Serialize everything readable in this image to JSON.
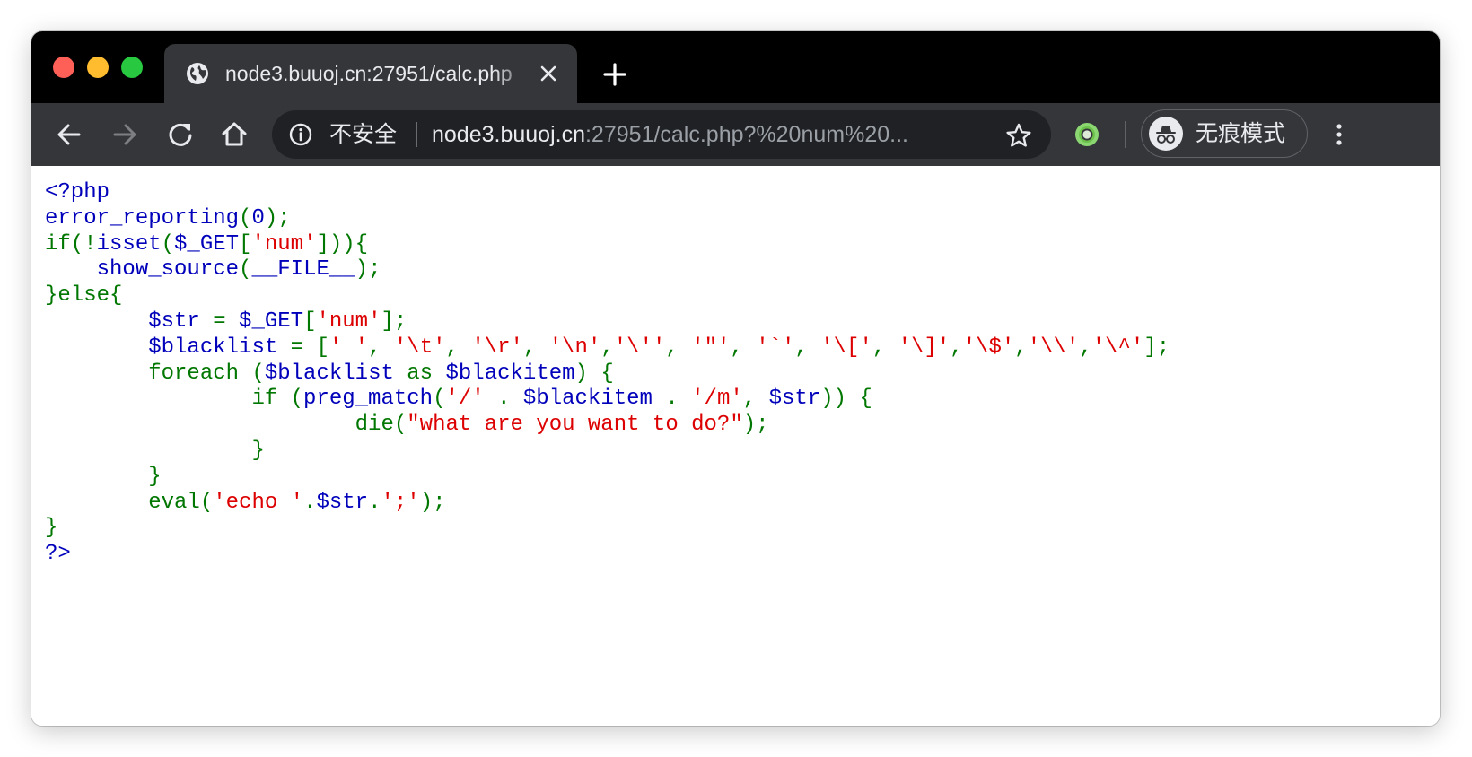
{
  "browser": {
    "tab": {
      "title": "node3.buuoj.cn:27951/calc.php"
    },
    "omnibox": {
      "security_label": "不安全",
      "url_host": "node3.buuoj.cn",
      "url_rest": ":27951/calc.php?%20num%20..."
    },
    "profile": {
      "label": "无痕模式"
    }
  },
  "colors": {
    "php_default": "#0000bb",
    "php_keyword": "#007700",
    "php_string": "#dd0000",
    "tabstrip_bg": "#000000",
    "toolbar_bg": "#35363a"
  },
  "icons": [
    "globe-icon",
    "close-icon",
    "plus-icon",
    "back-arrow-icon",
    "forward-arrow-icon",
    "reload-icon",
    "home-icon",
    "info-icon",
    "star-icon",
    "extension-icon",
    "incognito-icon",
    "kebab-menu-icon"
  ],
  "code": {
    "lines": [
      [
        {
          "t": "<?php",
          "c": "blue"
        }
      ],
      [
        {
          "t": "error_reporting",
          "c": "blue"
        },
        {
          "t": "(",
          "c": "green"
        },
        {
          "t": "0",
          "c": "blue"
        },
        {
          "t": ");",
          "c": "green"
        }
      ],
      [
        {
          "t": "if(!",
          "c": "green"
        },
        {
          "t": "isset",
          "c": "blue"
        },
        {
          "t": "(",
          "c": "green"
        },
        {
          "t": "$_GET",
          "c": "blue"
        },
        {
          "t": "[",
          "c": "green"
        },
        {
          "t": "'num'",
          "c": "red"
        },
        {
          "t": "])){",
          "c": "green"
        }
      ],
      [
        {
          "t": "    show_source",
          "c": "blue"
        },
        {
          "t": "(",
          "c": "green"
        },
        {
          "t": "__FILE__",
          "c": "blue"
        },
        {
          "t": ");",
          "c": "green"
        }
      ],
      [
        {
          "t": "}else{",
          "c": "green"
        }
      ],
      [
        {
          "t": "        $str ",
          "c": "blue"
        },
        {
          "t": "= ",
          "c": "green"
        },
        {
          "t": "$_GET",
          "c": "blue"
        },
        {
          "t": "[",
          "c": "green"
        },
        {
          "t": "'num'",
          "c": "red"
        },
        {
          "t": "];",
          "c": "green"
        }
      ],
      [
        {
          "t": "        $blacklist ",
          "c": "blue"
        },
        {
          "t": "= [",
          "c": "green"
        },
        {
          "t": "' '",
          "c": "red"
        },
        {
          "t": ", ",
          "c": "green"
        },
        {
          "t": "'\\t'",
          "c": "red"
        },
        {
          "t": ", ",
          "c": "green"
        },
        {
          "t": "'\\r'",
          "c": "red"
        },
        {
          "t": ", ",
          "c": "green"
        },
        {
          "t": "'\\n'",
          "c": "red"
        },
        {
          "t": ",",
          "c": "green"
        },
        {
          "t": "'\\''",
          "c": "red"
        },
        {
          "t": ", ",
          "c": "green"
        },
        {
          "t": "'\"'",
          "c": "red"
        },
        {
          "t": ", ",
          "c": "green"
        },
        {
          "t": "'`'",
          "c": "red"
        },
        {
          "t": ", ",
          "c": "green"
        },
        {
          "t": "'\\['",
          "c": "red"
        },
        {
          "t": ", ",
          "c": "green"
        },
        {
          "t": "'\\]'",
          "c": "red"
        },
        {
          "t": ",",
          "c": "green"
        },
        {
          "t": "'\\$'",
          "c": "red"
        },
        {
          "t": ",",
          "c": "green"
        },
        {
          "t": "'\\\\'",
          "c": "red"
        },
        {
          "t": ",",
          "c": "green"
        },
        {
          "t": "'\\^'",
          "c": "red"
        },
        {
          "t": "];",
          "c": "green"
        }
      ],
      [
        {
          "t": "        foreach (",
          "c": "green"
        },
        {
          "t": "$blacklist ",
          "c": "blue"
        },
        {
          "t": "as ",
          "c": "green"
        },
        {
          "t": "$blackitem",
          "c": "blue"
        },
        {
          "t": ") {",
          "c": "green"
        }
      ],
      [
        {
          "t": "                if (",
          "c": "green"
        },
        {
          "t": "preg_match",
          "c": "blue"
        },
        {
          "t": "(",
          "c": "green"
        },
        {
          "t": "'/' ",
          "c": "red"
        },
        {
          "t": ". ",
          "c": "green"
        },
        {
          "t": "$blackitem ",
          "c": "blue"
        },
        {
          "t": ". ",
          "c": "green"
        },
        {
          "t": "'/m'",
          "c": "red"
        },
        {
          "t": ", ",
          "c": "green"
        },
        {
          "t": "$str",
          "c": "blue"
        },
        {
          "t": ")) {",
          "c": "green"
        }
      ],
      [
        {
          "t": "                        die(",
          "c": "green"
        },
        {
          "t": "\"what are you want to do?\"",
          "c": "red"
        },
        {
          "t": ");",
          "c": "green"
        }
      ],
      [
        {
          "t": "                }",
          "c": "green"
        }
      ],
      [
        {
          "t": "        }",
          "c": "green"
        }
      ],
      [
        {
          "t": "        eval(",
          "c": "green"
        },
        {
          "t": "'echo '",
          "c": "red"
        },
        {
          "t": ".",
          "c": "green"
        },
        {
          "t": "$str",
          "c": "blue"
        },
        {
          "t": ".",
          "c": "green"
        },
        {
          "t": "';'",
          "c": "red"
        },
        {
          "t": ");",
          "c": "green"
        }
      ],
      [
        {
          "t": "}",
          "c": "green"
        }
      ],
      [
        {
          "t": "?>",
          "c": "blue"
        }
      ]
    ]
  }
}
